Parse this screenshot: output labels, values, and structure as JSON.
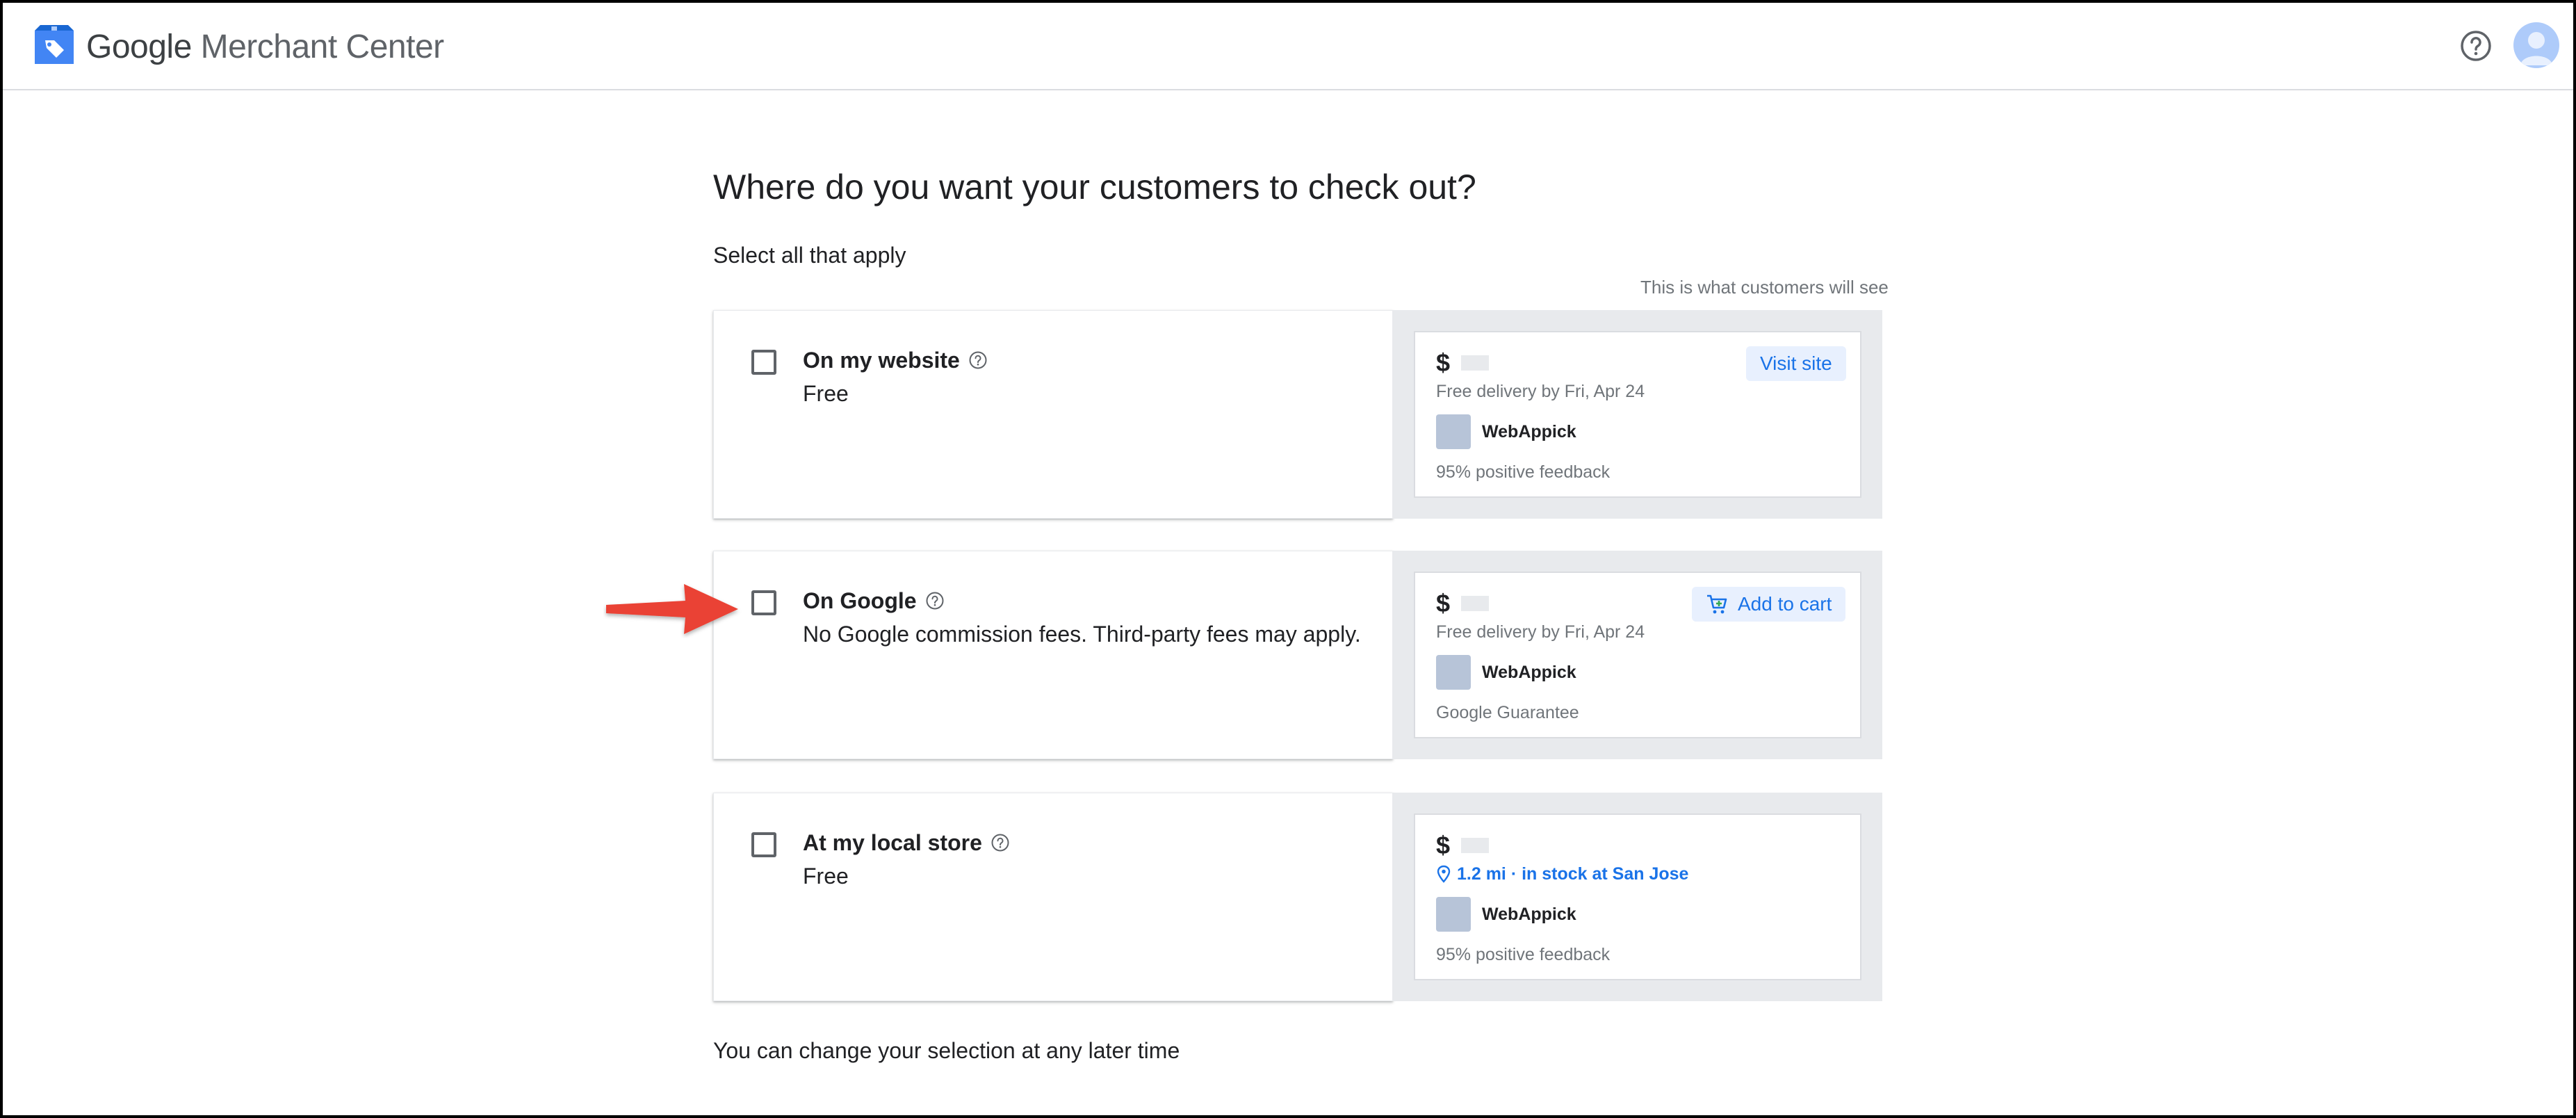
{
  "header": {
    "brand_google": "Google",
    "brand_product": "Merchant Center",
    "help_icon": "help-circle-icon",
    "avatar_icon": "account-avatar-icon"
  },
  "main": {
    "title": "Where do you want your customers to check out?",
    "subtitle": "Select all that apply",
    "customers_see": "This is what customers will see",
    "footer_note": "You can change your selection at any later time"
  },
  "options": [
    {
      "title": "On my website",
      "description": "Free",
      "checked": false,
      "preview": {
        "price_symbol": "$",
        "delivery": "Free delivery by Fri, Apr 24",
        "merchant": "WebAppick",
        "footer": "95% positive feedback",
        "action_label": "Visit site"
      }
    },
    {
      "title": "On Google",
      "description": "No Google commission fees. Third-party fees may apply.",
      "checked": false,
      "preview": {
        "price_symbol": "$",
        "delivery": "Free delivery by Fri, Apr 24",
        "merchant": "WebAppick",
        "footer": "Google Guarantee",
        "action_label": "Add to cart"
      }
    },
    {
      "title": "At my local store",
      "description": "Free",
      "checked": false,
      "preview": {
        "price_symbol": "$",
        "location": "1.2 mi · in stock at San Jose",
        "merchant": "WebAppick",
        "footer": "95% positive feedback"
      }
    }
  ],
  "colors": {
    "accent_blue": "#1a73e8",
    "annotation_arrow": "#ea4335",
    "panel_gray": "#e8eaed"
  }
}
